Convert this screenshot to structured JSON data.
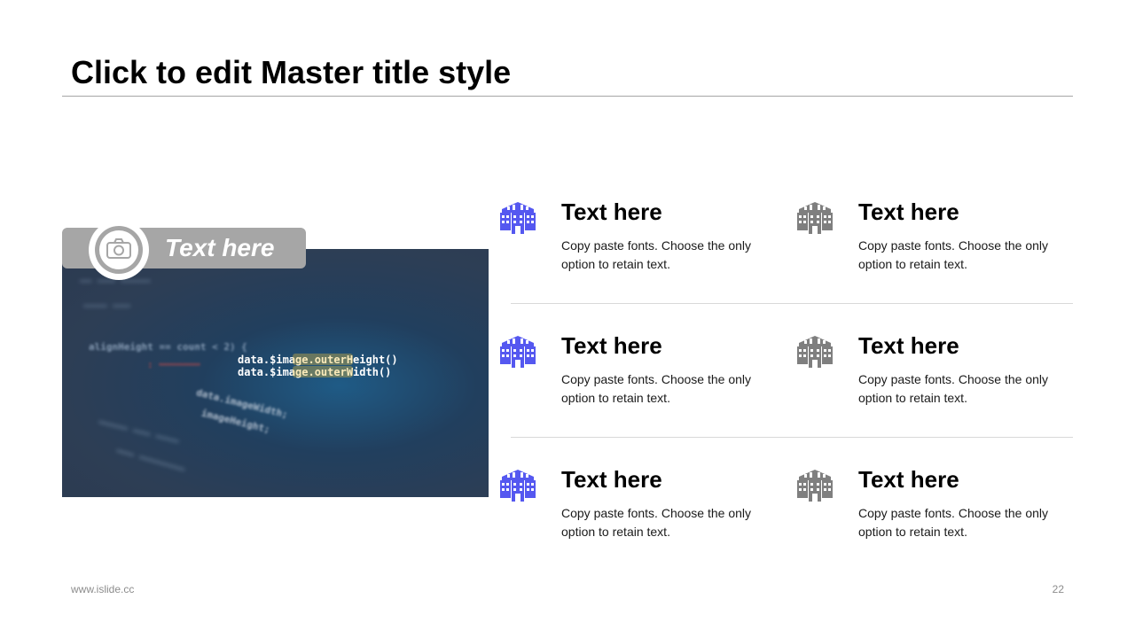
{
  "slide": {
    "title": "Click to edit Master title style",
    "footer_url": "www.islide.cc",
    "page_number": "22"
  },
  "photo": {
    "caption": "Text here",
    "icon": "camera-icon",
    "code_lines": [
      "alignHeight == count < 2) {",
      "data.$image.outerHeight()",
      "data.$image.outerWidth()",
      "data.imageWidth;",
      "imageHeight;"
    ]
  },
  "colors": {
    "accent": "#5558f0",
    "secondary": "#7f7f7f",
    "caption_bg": "#a6a6a6"
  },
  "items": [
    {
      "heading": "Text here",
      "body": "Copy paste fonts. Choose the only option to retain text.",
      "icon": "building-icon",
      "color": "#5558f0"
    },
    {
      "heading": "Text here",
      "body": "Copy paste fonts. Choose the only option to retain text.",
      "icon": "building-icon",
      "color": "#7f7f7f"
    },
    {
      "heading": "Text here",
      "body": "Copy paste fonts. Choose the only option to retain text.",
      "icon": "building-icon",
      "color": "#5558f0"
    },
    {
      "heading": "Text here",
      "body": "Copy paste fonts. Choose the only option to retain text.",
      "icon": "building-icon",
      "color": "#7f7f7f"
    },
    {
      "heading": "Text here",
      "body": "Copy paste fonts. Choose the only option to retain text.",
      "icon": "building-icon",
      "color": "#5558f0"
    },
    {
      "heading": "Text here",
      "body": "Copy paste fonts. Choose the only option to retain text.",
      "icon": "building-icon",
      "color": "#7f7f7f"
    }
  ]
}
